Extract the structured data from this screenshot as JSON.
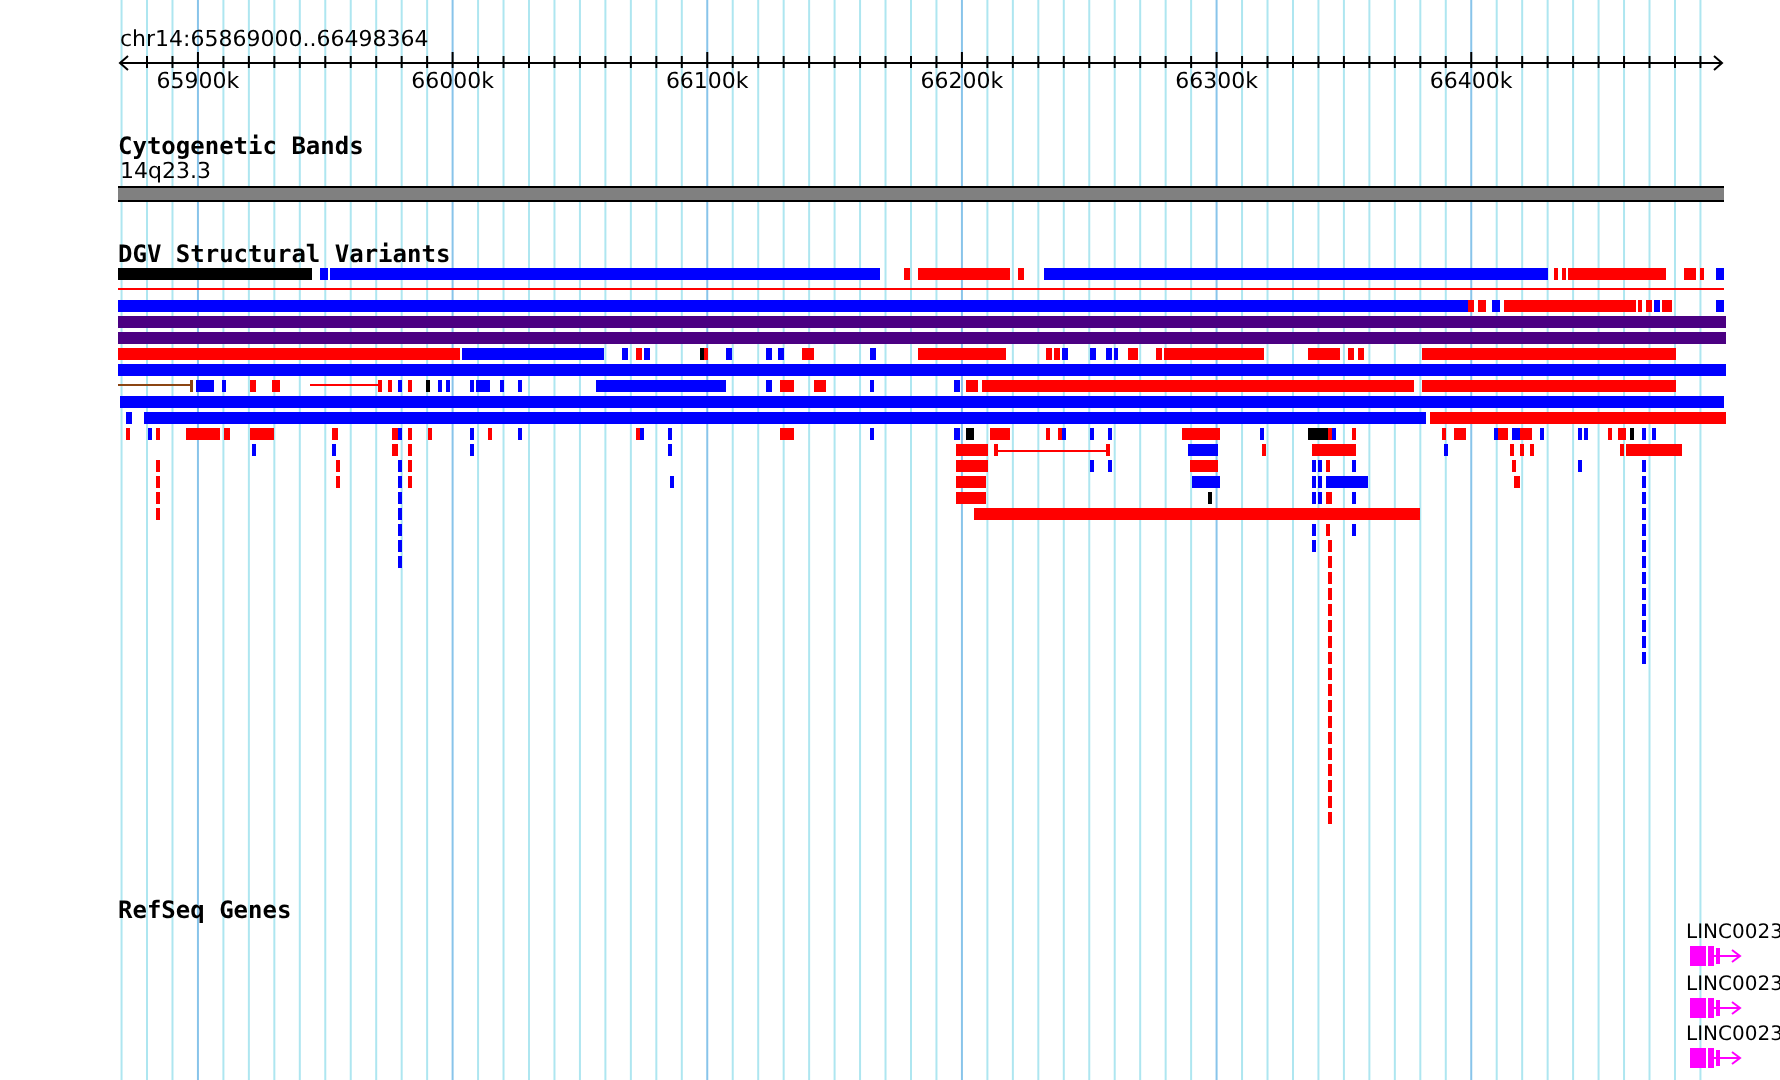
{
  "region": {
    "label": "chr14:65869000..66498364",
    "ticks": [
      "65900k",
      "66000k",
      "66100k",
      "66200k",
      "66300k",
      "66400k"
    ]
  },
  "tracks": [
    {
      "kind": "bands",
      "title": "Cytogenetic Bands",
      "band_label": "14q23.3"
    },
    {
      "kind": "variants",
      "title": "DGV Structural Variants"
    },
    {
      "kind": "genes",
      "title": "RefSeq Genes",
      "genes": [
        {
          "label": "LINC0023"
        },
        {
          "label": "LINC0023"
        },
        {
          "label": "LINC0023"
        }
      ]
    }
  ]
}
